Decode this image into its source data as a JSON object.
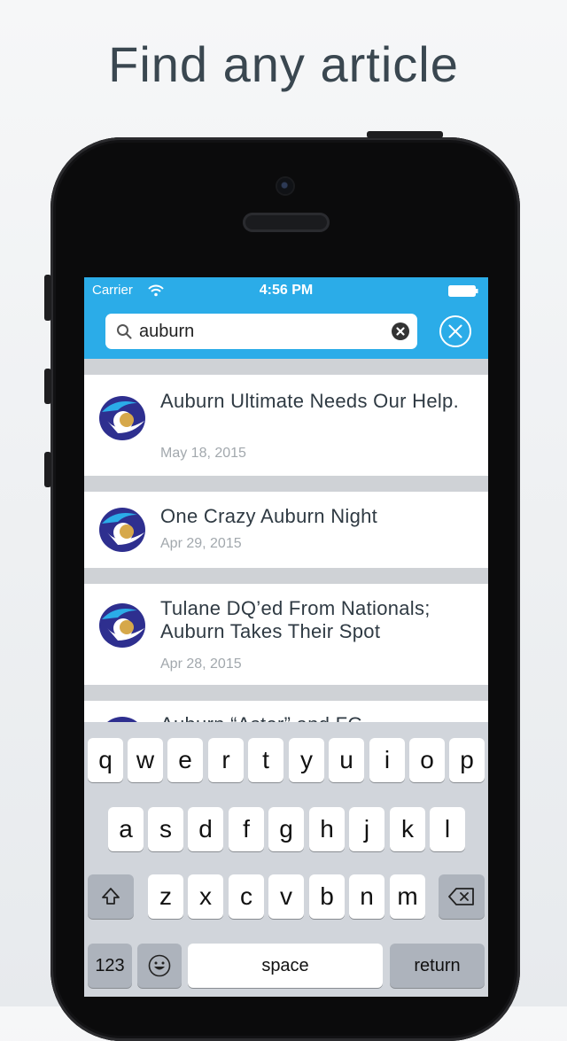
{
  "headline": "Find any article",
  "status": {
    "carrier": "Carrier",
    "time": "4:56 PM"
  },
  "search": {
    "value": "auburn"
  },
  "results": [
    {
      "title": "Auburn Ultimate Needs Our Help.",
      "date": "May 18, 2015"
    },
    {
      "title": "One Crazy Auburn Night",
      "date": "Apr 29, 2015"
    },
    {
      "title": "Tulane DQ’ed From Nationals; Auburn Takes Their Spot",
      "date": "Apr 28, 2015"
    },
    {
      "title": "Auburn “Aster” and FG",
      "date": ""
    }
  ],
  "keyboard": {
    "row1": [
      "q",
      "w",
      "e",
      "r",
      "t",
      "y",
      "u",
      "i",
      "o",
      "p"
    ],
    "row2": [
      "a",
      "s",
      "d",
      "f",
      "g",
      "h",
      "j",
      "k",
      "l"
    ],
    "row3": [
      "z",
      "x",
      "c",
      "v",
      "b",
      "n",
      "m"
    ],
    "numbers": "123",
    "space": "space",
    "return": "return"
  },
  "colors": {
    "accent": "#2bace8",
    "keyboard_bg": "#d1d5db",
    "logo_navy": "#2e2f8f",
    "logo_gold": "#d6a84a"
  }
}
